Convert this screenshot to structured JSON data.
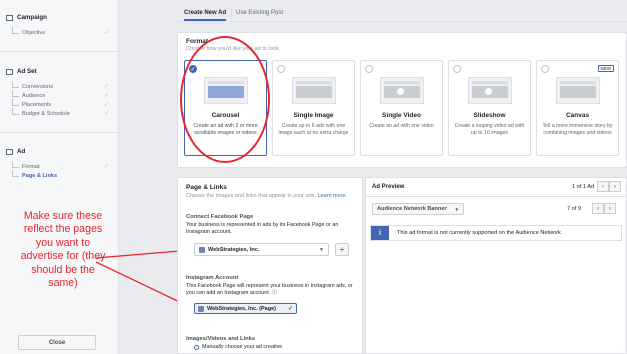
{
  "sidebar": {
    "campaign": {
      "label": "Campaign",
      "items": [
        {
          "label": "Objective",
          "check": "✓"
        }
      ]
    },
    "adset": {
      "label": "Ad Set",
      "items": [
        {
          "label": "Conversions",
          "check": "✓"
        },
        {
          "label": "Audience",
          "check": "✓"
        },
        {
          "label": "Placements",
          "check": "✓"
        },
        {
          "label": "Budget & Schedule",
          "check": "✓"
        }
      ]
    },
    "ad": {
      "label": "Ad",
      "items": [
        {
          "label": "Format",
          "check": "✓"
        },
        {
          "label": "Page & Links",
          "check": ""
        }
      ]
    },
    "close_label": "Close"
  },
  "tabs": {
    "create_new": "Create New Ad",
    "use_existing": "Use Existing Post"
  },
  "format": {
    "title": "Format",
    "subtitle": "Choose how you'd like your ad to look.",
    "options": [
      {
        "name": "Carousel",
        "desc": "Create an ad with 2 or more scrollable images or videos",
        "selected": true
      },
      {
        "name": "Single Image",
        "desc": "Create up to 6 ads with one image each at no extra charge"
      },
      {
        "name": "Single Video",
        "desc": "Create an ad with one video"
      },
      {
        "name": "Slideshow",
        "desc": "Create a looping video ad with up to 10 images"
      },
      {
        "name": "Canvas",
        "desc": "Tell a more immersive story by combining images and videos",
        "badge": "NEW"
      }
    ]
  },
  "page_links": {
    "title": "Page & Links",
    "subtitle": "Choose the images and links that appear in your ads.",
    "learn_more": "Learn more.",
    "connect": {
      "heading": "Connect Facebook Page",
      "text": "Your business is represented in ads by its Facebook Page or an Instagram account.",
      "selected_page": "WebStrategies, Inc.",
      "add_label": "+"
    },
    "instagram": {
      "heading": "Instagram Account",
      "text": "This Facebook Page will represent your business in Instagram ads, or you can add an Instagram account.",
      "info_mark": "ⓘ",
      "selected": "WebStrategies, Inc. (Page)"
    },
    "images": {
      "heading": "Images/Videos and Links",
      "option": "Manually choose your ad creative"
    }
  },
  "preview": {
    "title": "Ad Preview",
    "count": "1 of 1 Ad",
    "placement": "Audience Network Banner",
    "placement_count": "7 of 9",
    "info_text": "This ad format is not currently supported on the Audience Network"
  },
  "annotation": {
    "text": "Make sure these reflect the pages you want to advertise for (they should be the same)",
    "color": "#e8262c"
  },
  "colors": {
    "accent": "#4267b2",
    "annotation": "#e8262c",
    "background": "#e9ebee"
  }
}
